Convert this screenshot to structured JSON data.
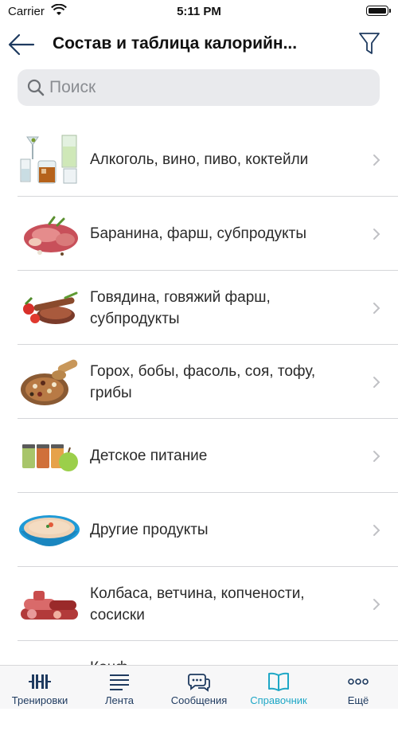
{
  "status": {
    "carrier": "Carrier",
    "time": "5:11 PM"
  },
  "nav": {
    "title": "Состав и таблица калорийн..."
  },
  "search": {
    "placeholder": "Поиск"
  },
  "categories": [
    {
      "label": "Алкоголь, вино, пиво, коктейли",
      "icon": "drinks-image"
    },
    {
      "label": "Баранина, фарш, субпродукты",
      "icon": "lamb-image"
    },
    {
      "label": "Говядина, говяжий фарш, субпродукты",
      "icon": "beef-image"
    },
    {
      "label": "Горох, бобы, фасоль, соя, тофу, грибы",
      "icon": "beans-image"
    },
    {
      "label": "Детское питание",
      "icon": "baby-food-image"
    },
    {
      "label": "Другие продукты",
      "icon": "soup-bowl-image"
    },
    {
      "label": "Колбаса, ветчина, копчености, сосиски",
      "icon": "sausage-image"
    },
    {
      "label": "Конф",
      "icon": "candy-image"
    }
  ],
  "tabs": [
    {
      "label": "Тренировки",
      "icon": "dumbbell-icon",
      "active": false
    },
    {
      "label": "Лента",
      "icon": "feed-icon",
      "active": false
    },
    {
      "label": "Сообщения",
      "icon": "messages-icon",
      "active": false
    },
    {
      "label": "Справочник",
      "icon": "book-icon",
      "active": true
    },
    {
      "label": "Ещё",
      "icon": "more-icon",
      "active": false
    }
  ],
  "colors": {
    "accent": "#1ea7c6",
    "nav_icon": "#1e3a5f"
  }
}
